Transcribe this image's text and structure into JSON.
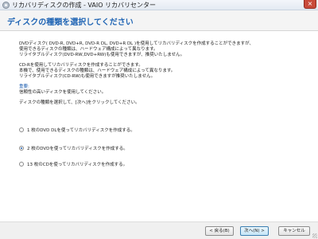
{
  "window": {
    "title": "リカバリディスクの作成 - VAIO リカバリセンター",
    "close_glyph": "×"
  },
  "header": {
    "title": "ディスクの種類を選択してください"
  },
  "content": {
    "para1": [
      "DVDディスク( DVD-R, DVD+R, DVD-R DL, DVD+R DL )を使用してリカバリディスクを作成することができますが、",
      "使用できるディスクの種類は、ハードウェア構成によって異なります。",
      "リライタブルディスク(DVD-RW,DVD+RW)も使用できますが、推奨いたしません。"
    ],
    "para2": [
      "CD-Rを使用してリカバリディスクを作成することができます。",
      "本機で、使用できるディスクの種類は、ハードウェア構成によって異なります。",
      "リライタブルディスク(CD-RW)も使用できますが推奨いたしません。"
    ],
    "note_heading": "重要:",
    "note_text": "信頼性の高いディスクを使用してください。",
    "instruction": "ディスクの種類を選択して、[次へ]をクリックしてください。"
  },
  "options": [
    {
      "label": "1 枚のDVD DLを使ってリカバリディスクを作成する。",
      "selected": false
    },
    {
      "label": "2 枚のDVDを使ってリカバリディスクを作成する。",
      "selected": true
    },
    {
      "label": "13 枚のCDを使ってリカバリディスクを作成する。",
      "selected": false
    }
  ],
  "footer": {
    "back_label": "< 戻る(B)",
    "next_label": "次へ(N) >",
    "cancel_label": "キャンセル"
  }
}
